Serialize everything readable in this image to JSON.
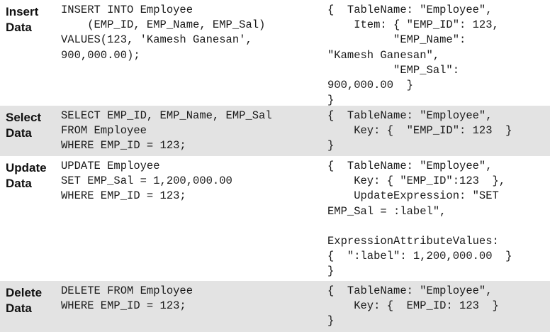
{
  "rows": [
    {
      "label": "Insert\nData",
      "sql": "INSERT INTO Employee\n    (EMP_ID, EMP_Name, EMP_Sal)\nVALUES(123, 'Kamesh Ganesan',\n900,000.00);",
      "json": "{  TableName: \"Employee\",\n    Item: { \"EMP_ID\": 123,\n          \"EMP_Name\":\n\"Kamesh Ganesan\",\n          \"EMP_Sal\":\n900,000.00  }\n}"
    },
    {
      "label": "Select\nData",
      "sql": "SELECT EMP_ID, EMP_Name, EMP_Sal\nFROM Employee\nWHERE EMP_ID = 123;",
      "json": "{  TableName: \"Employee\",\n    Key: {  \"EMP_ID\": 123  }\n}"
    },
    {
      "label": "Update\nData",
      "sql": "UPDATE Employee\nSET EMP_Sal = 1,200,000.00\nWHERE EMP_ID = 123;",
      "json": "{  TableName: \"Employee\",\n    Key: { \"EMP_ID\":123  },\n    UpdateExpression: \"SET\nEMP_Sal = :label\",\n\nExpressionAttributeValues:\n{  \":label\": 1,200,000.00  }\n}"
    },
    {
      "label": "Delete\nData",
      "sql": "DELETE FROM Employee\nWHERE EMP_ID = 123;",
      "json": "{  TableName: \"Employee\",\n    Key: {  EMP_ID: 123  }\n}"
    }
  ]
}
